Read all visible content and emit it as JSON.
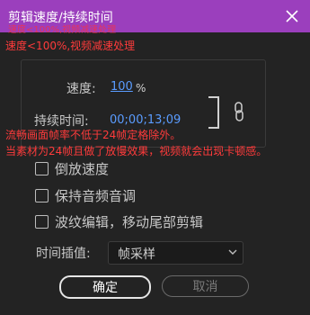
{
  "window": {
    "title": "剪辑速度/持续时间",
    "titlebar_color": "#9b3fbd",
    "close_icon": "close-icon"
  },
  "annotations": {
    "faint_note": "速度<100%,视频减速处理",
    "speed_note": "速度<100%,视频减速处理",
    "framerate_note": "流畅画面帧率不低于24帧定格除外。",
    "warning_note": "当素材为24帧且做了放慢效果，视频就会出现卡顿感。"
  },
  "speed": {
    "label": "速度:",
    "value": "100",
    "unit": "%"
  },
  "duration": {
    "label": "持续时间:",
    "value": "00;00;13;09"
  },
  "link_icon": "chain-link-icon",
  "checkboxes": [
    {
      "label": "倒放速度",
      "checked": false
    },
    {
      "label": "保持音频音调",
      "checked": false
    },
    {
      "label": "波纹编辑，移动尾部剪辑",
      "checked": false
    }
  ],
  "interpolation": {
    "label": "时间插值:",
    "selected": "帧采样"
  },
  "buttons": {
    "ok": "确定",
    "cancel": "取消"
  },
  "colors": {
    "accent_blue": "#5a9cff",
    "annotation_red": "#ff3b3b",
    "background": "#232323"
  }
}
